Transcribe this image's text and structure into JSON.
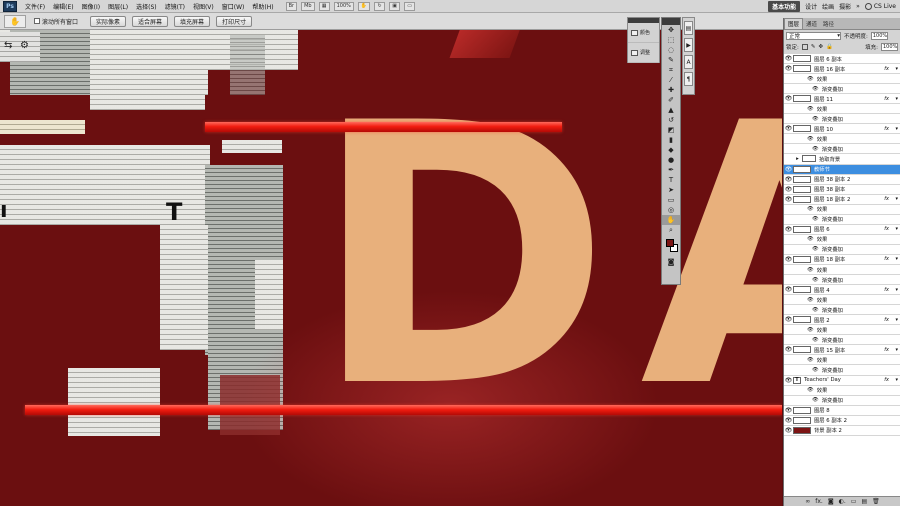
{
  "menubar": {
    "logo": "Ps",
    "items": [
      "文件(F)",
      "编辑(E)",
      "图像(I)",
      "图层(L)",
      "选择(S)",
      "滤镜(T)",
      "视图(V)",
      "窗口(W)",
      "帮助(H)"
    ],
    "icons": [
      "Br",
      "Mb",
      "100%"
    ],
    "workspaces": {
      "active": "基本功能",
      "others": [
        "设计",
        "绘画",
        "摄影"
      ],
      "more": "»",
      "cslive": "CS Live"
    }
  },
  "optionsbar": {
    "tool_icon": "hand-tool",
    "checkbox_label": "滚动所有窗口",
    "buttons": [
      "实际像素",
      "适合屏幕",
      "填充屏幕",
      "打印尺寸"
    ]
  },
  "canvas": {
    "letters": [
      "D",
      "A"
    ],
    "t_letter": "T",
    "colors": {
      "background": "#6b0f10",
      "letter": "#e8b07c",
      "bar": "#f21c10"
    }
  },
  "minipanel": {
    "items": [
      "颜色",
      "调整"
    ]
  },
  "tools": [
    "move",
    "marquee",
    "lasso",
    "quick-select",
    "crop",
    "eyedropper",
    "healing",
    "brush",
    "stamp",
    "history-brush",
    "eraser",
    "gradient",
    "blur",
    "dodge",
    "pen",
    "type",
    "path-select",
    "rectangle",
    "hand",
    "zoom"
  ],
  "layers": {
    "tabs": [
      "图层",
      "通道",
      "路径"
    ],
    "blend_mode": "正常",
    "opacity_label": "不透明度:",
    "opacity_value": "100%",
    "lock_label": "锁定:",
    "fill_label": "填充:",
    "fill_value": "100%",
    "rows": [
      {
        "name": "图层 6 副本",
        "kind": "layer"
      },
      {
        "name": "图层 16 副本",
        "kind": "layer",
        "fx": true
      },
      {
        "name": "效果",
        "kind": "effects"
      },
      {
        "name": "渐变叠加",
        "kind": "effect"
      },
      {
        "name": "图层 11",
        "kind": "layer",
        "fx": true
      },
      {
        "name": "效果",
        "kind": "effects"
      },
      {
        "name": "渐变叠加",
        "kind": "effect"
      },
      {
        "name": "图层 10",
        "kind": "layer",
        "fx": true
      },
      {
        "name": "效果",
        "kind": "effects"
      },
      {
        "name": "渐变叠加",
        "kind": "effect"
      },
      {
        "name": "拾取背景",
        "kind": "group"
      },
      {
        "name": "教师节",
        "kind": "layer",
        "selected": true
      },
      {
        "name": "图层 38 副本 2",
        "kind": "layer"
      },
      {
        "name": "图层 38 副本",
        "kind": "layer"
      },
      {
        "name": "图层 18 副本 2",
        "kind": "layer",
        "fx": true
      },
      {
        "name": "效果",
        "kind": "effects"
      },
      {
        "name": "渐变叠加",
        "kind": "effect"
      },
      {
        "name": "图层 6",
        "kind": "layer",
        "fx": true
      },
      {
        "name": "效果",
        "kind": "effects"
      },
      {
        "name": "渐变叠加",
        "kind": "effect"
      },
      {
        "name": "图层 18 副本",
        "kind": "layer",
        "fx": true
      },
      {
        "name": "效果",
        "kind": "effects"
      },
      {
        "name": "渐变叠加",
        "kind": "effect"
      },
      {
        "name": "图层 4",
        "kind": "layer",
        "fx": true
      },
      {
        "name": "效果",
        "kind": "effects"
      },
      {
        "name": "渐变叠加",
        "kind": "effect"
      },
      {
        "name": "图层 2",
        "kind": "layer",
        "fx": true
      },
      {
        "name": "效果",
        "kind": "effects"
      },
      {
        "name": "渐变叠加",
        "kind": "effect"
      },
      {
        "name": "图层 15 副本",
        "kind": "layer",
        "fx": true
      },
      {
        "name": "效果",
        "kind": "effects"
      },
      {
        "name": "渐变叠加",
        "kind": "effect"
      },
      {
        "name": "Teachers' Day",
        "kind": "text",
        "fx": true
      },
      {
        "name": "效果",
        "kind": "effects"
      },
      {
        "name": "渐变叠加",
        "kind": "effect"
      },
      {
        "name": "图层 8",
        "kind": "layer"
      },
      {
        "name": "图层 6 副本 2",
        "kind": "layer"
      },
      {
        "name": "背景 副本 2",
        "kind": "layer",
        "red": true
      }
    ],
    "footer": [
      "∞",
      "fx.",
      "◙",
      "◐.",
      "▭",
      "▤",
      "🗑"
    ]
  }
}
